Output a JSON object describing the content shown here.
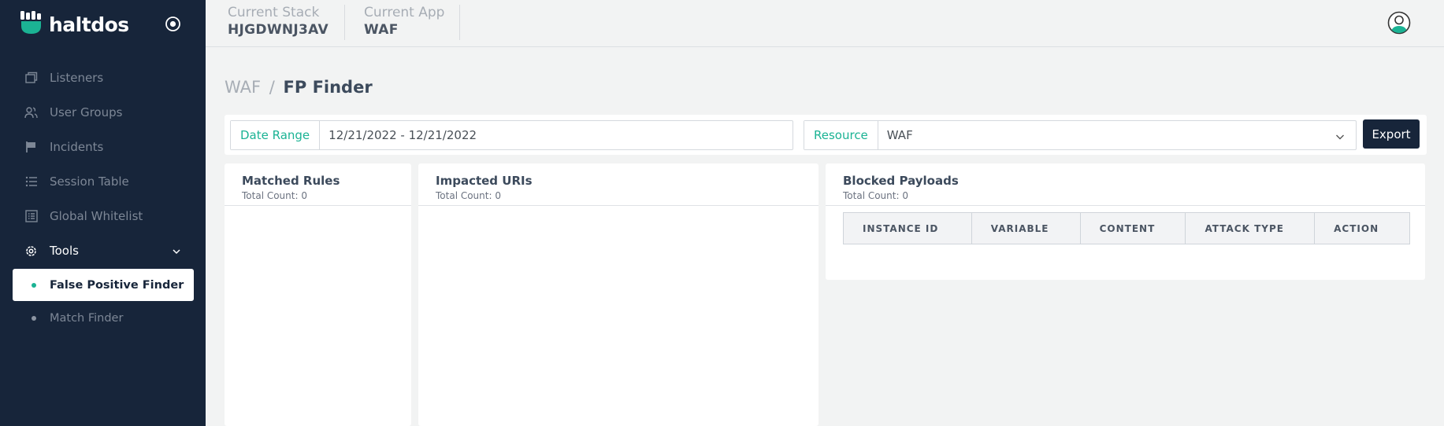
{
  "app": {
    "logo_text": "haltdos"
  },
  "colors": {
    "sidebar_bg": "#17253a",
    "accent": "#1bb394",
    "export_bg": "#17253a",
    "page_bg": "#f2f3f3"
  },
  "sidebar": {
    "items": [
      {
        "label": "Listeners",
        "icon": "window-icon"
      },
      {
        "label": "User Groups",
        "icon": "users-icon"
      },
      {
        "label": "Incidents",
        "icon": "flag-icon"
      },
      {
        "label": "Session Table",
        "icon": "list-icon"
      },
      {
        "label": "Global Whitelist",
        "icon": "table-list-icon"
      }
    ],
    "tools": {
      "label": "Tools",
      "icon": "gear-icon",
      "subitems": [
        {
          "label": "False Positive Finder",
          "active": true
        },
        {
          "label": "Match Finder",
          "active": false
        }
      ]
    }
  },
  "header": {
    "stack_label": "Current Stack",
    "stack_value": "HJGDWNJ3AV",
    "app_label": "Current App",
    "app_value": "WAF"
  },
  "breadcrumb": {
    "parent": "WAF",
    "separator": "/",
    "current": "FP Finder"
  },
  "filters": {
    "date_range_label": "Date Range",
    "date_range_value": "12/21/2022 - 12/21/2022",
    "resource_label": "Resource",
    "resource_value": "WAF",
    "export_label": "Export"
  },
  "cards": {
    "matched_rules": {
      "title": "Matched Rules",
      "subtitle": "Total Count: 0"
    },
    "impacted_uris": {
      "title": "Impacted URIs",
      "subtitle": "Total Count: 0"
    },
    "blocked_payloads": {
      "title": "Blocked Payloads",
      "subtitle": "Total Count: 0",
      "columns": [
        "INSTANCE ID",
        "VARIABLE",
        "CONTENT",
        "ATTACK TYPE",
        "ACTION"
      ]
    }
  }
}
